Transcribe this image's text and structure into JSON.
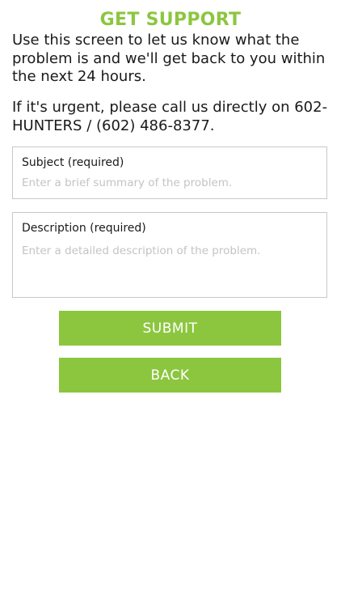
{
  "header": {
    "title": "GET SUPPORT"
  },
  "intro": {
    "paragraph1": "Use this screen to let us know what the problem is and we'll get back to you within the next 24 hours.",
    "paragraph2": "If it's urgent, please call us directly on 602-HUNTERS / (602) 486-8377."
  },
  "form": {
    "subject": {
      "label": "Subject (required)",
      "placeholder": "Enter a brief summary of the problem.",
      "value": ""
    },
    "description": {
      "label": "Description (required)",
      "placeholder": "Enter a detailed description of the problem.",
      "value": ""
    }
  },
  "actions": {
    "submit_label": "SUBMIT",
    "back_label": "BACK"
  },
  "colors": {
    "accent": "#8cc63f",
    "text": "#1a1a1a",
    "placeholder": "#c4c4c4",
    "border": "#c8c8c8",
    "button_text": "#ffffff"
  }
}
